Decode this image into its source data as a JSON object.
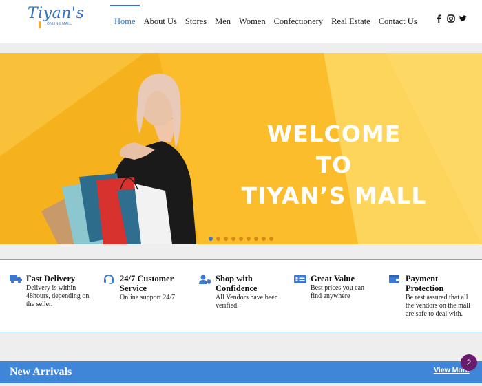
{
  "brand": {
    "name": "Tiyan's",
    "tagline": "ONLINE MALL"
  },
  "nav": {
    "items": [
      {
        "label": "Home",
        "active": true
      },
      {
        "label": "About Us",
        "active": false
      },
      {
        "label": "Stores",
        "active": false
      },
      {
        "label": "Men",
        "active": false
      },
      {
        "label": "Women",
        "active": false
      },
      {
        "label": "Confectionery",
        "active": false
      },
      {
        "label": "Real Estate",
        "active": false
      },
      {
        "label": "Contact Us",
        "active": false
      }
    ]
  },
  "social": [
    "facebook-icon",
    "instagram-icon",
    "twitter-icon"
  ],
  "hero": {
    "line1": "WELCOME",
    "line2": "TO",
    "line3": "TIYAN’S MALL",
    "slide_count": 9,
    "active_slide": 1
  },
  "features": [
    {
      "icon": "truck-icon",
      "title": "Fast Delivery",
      "desc": [
        "Delivery is within",
        "48hours, depending on",
        "the seller."
      ]
    },
    {
      "icon": "headset-icon",
      "title": "24/7 Customer Service",
      "title_lines": [
        "24/7 Customer",
        "Service"
      ],
      "desc": [
        "Online support 24/7"
      ]
    },
    {
      "icon": "user-shield-icon",
      "title": "Shop with Confidence",
      "title_lines": [
        "Shop with",
        "Confidence"
      ],
      "desc": [
        "All Vendors have been",
        "verified."
      ]
    },
    {
      "icon": "price-tag-icon",
      "title": "Great Value",
      "desc": [
        "Best prices you can",
        "find anywhere"
      ]
    },
    {
      "icon": "wallet-icon",
      "title": "Payment Protection",
      "title_lines": [
        "Payment",
        "Protection"
      ],
      "desc": [
        "Be rest assured that all",
        "the vendors on the mall",
        "are safe to deal with."
      ]
    }
  ],
  "arrivals": {
    "title": "New Arrivals",
    "view_more": "View More"
  },
  "notification_count": "2",
  "colors": {
    "accent": "#2e74c9",
    "hero_bg": "#f6b21c",
    "arrivals_bar": "#3f86d9",
    "badge": "#6b1a6e"
  }
}
